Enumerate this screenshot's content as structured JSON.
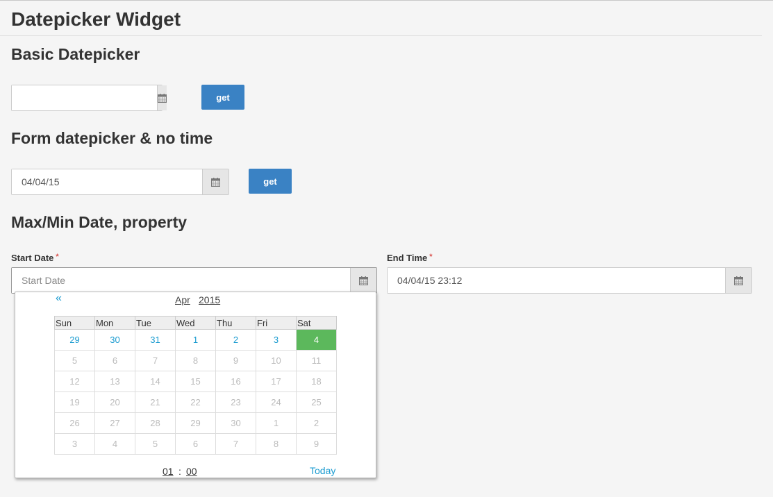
{
  "page_title": "Datepicker Widget",
  "sections": {
    "basic": {
      "title": "Basic Datepicker",
      "input_value": "",
      "button_label": "get"
    },
    "form": {
      "title": "Form datepicker & no time",
      "input_value": "04/04/15",
      "button_label": "get"
    },
    "maxmin": {
      "title": "Max/Min Date, property",
      "start_label": "Start Date",
      "start_required": "*",
      "start_placeholder": "Start Date",
      "end_label": "End Time",
      "end_required": "*",
      "end_value": "04/04/15 23:12"
    }
  },
  "icons": {
    "calendar": "calendar-icon",
    "prev": "double-chevron-left-icon"
  },
  "colors": {
    "accent_button": "#3a82c4",
    "selected_day": "#5cb85c",
    "link": "#1a9bd0",
    "required": "#d9534f"
  },
  "picker": {
    "prev_symbol": "«",
    "month": "Apr",
    "year": "2015",
    "weekdays": [
      "Sun",
      "Mon",
      "Tue",
      "Wed",
      "Thu",
      "Fri",
      "Sat"
    ],
    "weeks": [
      [
        "29",
        "30",
        "31",
        "1",
        "2",
        "3",
        "4"
      ],
      [
        "5",
        "6",
        "7",
        "8",
        "9",
        "10",
        "11"
      ],
      [
        "12",
        "13",
        "14",
        "15",
        "16",
        "17",
        "18"
      ],
      [
        "19",
        "20",
        "21",
        "22",
        "23",
        "24",
        "25"
      ],
      [
        "26",
        "27",
        "28",
        "29",
        "30",
        "1",
        "2"
      ],
      [
        "3",
        "4",
        "5",
        "6",
        "7",
        "8",
        "9"
      ]
    ],
    "enabled_days": 7,
    "selected_day": "4",
    "hour": "01",
    "time_sep": ":",
    "minute": "00",
    "today_label": "Today"
  }
}
